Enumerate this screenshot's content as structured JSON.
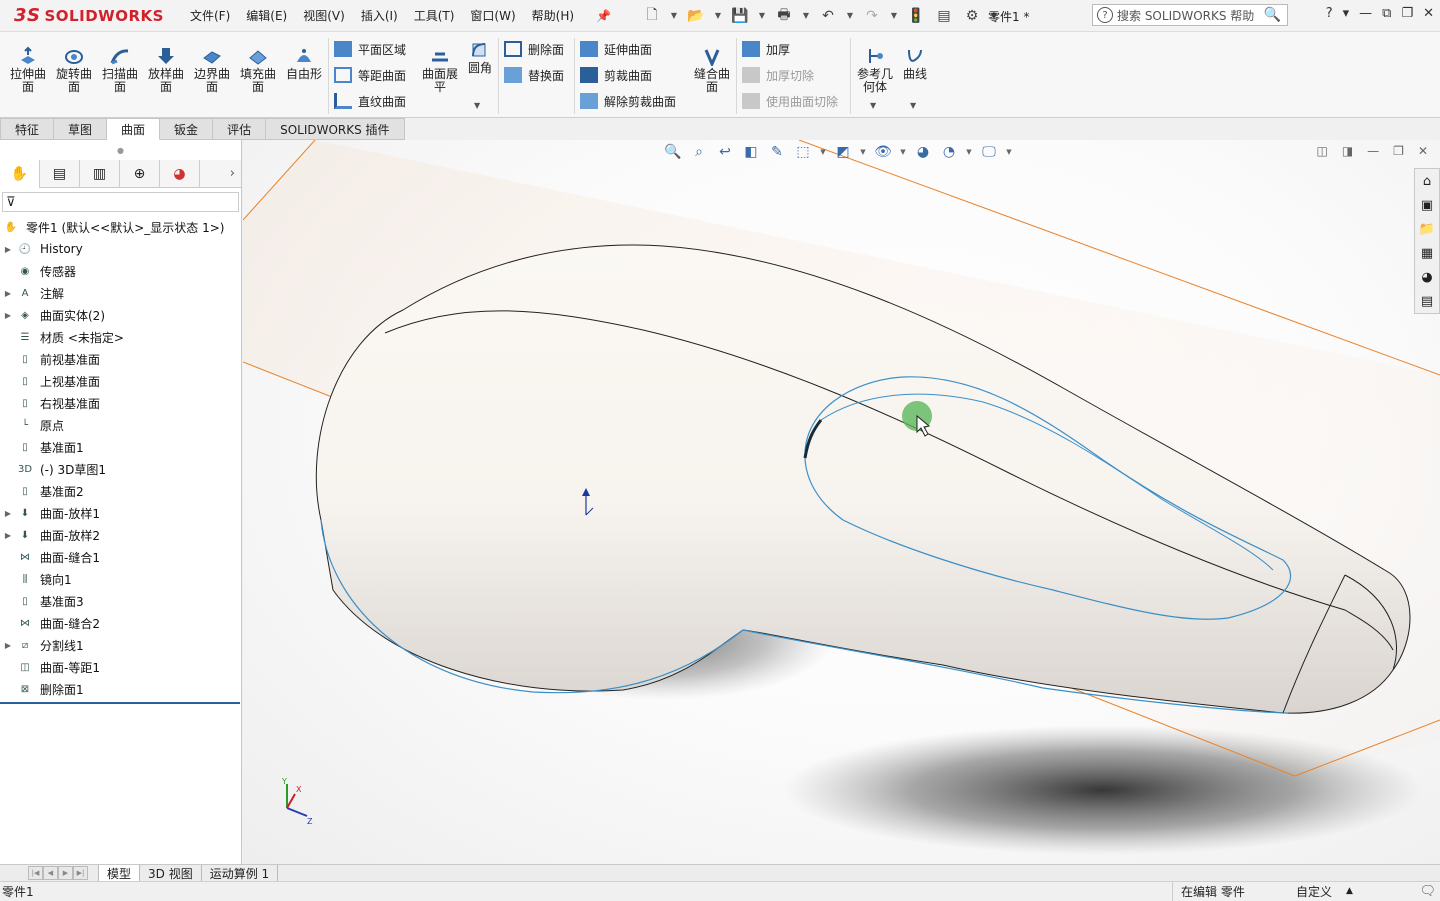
{
  "app": {
    "logo_ds": "3S",
    "logo_text": "SOLIDWORKS",
    "doc_title": "零件1 *",
    "search_placeholder": "搜索 SOLIDWORKS 帮助",
    "help_label": "?"
  },
  "menu": [
    "文件(F)",
    "编辑(E)",
    "视图(V)",
    "插入(I)",
    "工具(T)",
    "窗口(W)",
    "帮助(H)"
  ],
  "ribbon": {
    "big_buttons": [
      "拉伸曲面",
      "旋转曲面",
      "扫描曲面",
      "放样曲面",
      "边界曲面",
      "填充曲面",
      "自由形"
    ],
    "surface_col": [
      "平面区域",
      "等距曲面",
      "直纹曲面"
    ],
    "flatten": "曲面展平",
    "fillet": "圆角",
    "face_col": [
      "删除面",
      "替换面"
    ],
    "trim_col": [
      "延伸曲面",
      "剪裁曲面",
      "解除剪裁曲面"
    ],
    "knit": "缝合曲面",
    "thicken_col": [
      "加厚",
      "加厚切除",
      "使用曲面切除"
    ],
    "ref_geom": "参考几何体",
    "curves": "曲线"
  },
  "tabs": [
    "特征",
    "草图",
    "曲面",
    "钣金",
    "评估",
    "SOLIDWORKS 插件"
  ],
  "active_tab": "曲面",
  "tree": {
    "root": "零件1 (默认<<默认>_显示状态 1>)",
    "items": [
      {
        "label": "History",
        "exp": true,
        "icon": "history-icon"
      },
      {
        "label": "传感器",
        "exp": false,
        "icon": "sensor-icon"
      },
      {
        "label": "注解",
        "exp": true,
        "icon": "annotation-icon"
      },
      {
        "label": "曲面实体(2)",
        "exp": true,
        "icon": "surface-bodies-icon"
      },
      {
        "label": "材质 <未指定>",
        "exp": false,
        "icon": "material-icon"
      },
      {
        "label": "前视基准面",
        "exp": false,
        "icon": "plane-icon"
      },
      {
        "label": "上视基准面",
        "exp": false,
        "icon": "plane-icon"
      },
      {
        "label": "右视基准面",
        "exp": false,
        "icon": "plane-icon"
      },
      {
        "label": "原点",
        "exp": false,
        "icon": "origin-icon"
      },
      {
        "label": "基准面1",
        "exp": false,
        "icon": "plane-icon"
      },
      {
        "label": "(-) 3D草图1",
        "exp": false,
        "icon": "sketch3d-icon"
      },
      {
        "label": "基准面2",
        "exp": false,
        "icon": "plane-icon"
      },
      {
        "label": "曲面-放样1",
        "exp": true,
        "icon": "loft-icon"
      },
      {
        "label": "曲面-放样2",
        "exp": true,
        "icon": "loft-icon"
      },
      {
        "label": "曲面-缝合1",
        "exp": false,
        "icon": "knit-icon"
      },
      {
        "label": "镜向1",
        "exp": false,
        "icon": "mirror-icon"
      },
      {
        "label": "基准面3",
        "exp": false,
        "icon": "plane-icon"
      },
      {
        "label": "曲面-缝合2",
        "exp": false,
        "icon": "knit-icon"
      },
      {
        "label": "分割线1",
        "exp": true,
        "icon": "splitline-icon"
      },
      {
        "label": "曲面-等距1",
        "exp": false,
        "icon": "offset-icon"
      },
      {
        "label": "删除面1",
        "exp": false,
        "icon": "delete-face-icon"
      }
    ]
  },
  "bottom_tabs": [
    "模型",
    "3D 视图",
    "运动算例 1"
  ],
  "status": {
    "left": "零件1",
    "edit": "在编辑 零件",
    "units": "自定义"
  },
  "triad": {
    "x": "X",
    "y": "Y",
    "z": "Z"
  },
  "colors": {
    "accent": "#2b5f99",
    "brand": "#d0222d",
    "plane": "#e8822a",
    "edge_blue": "#3a8fc8"
  }
}
